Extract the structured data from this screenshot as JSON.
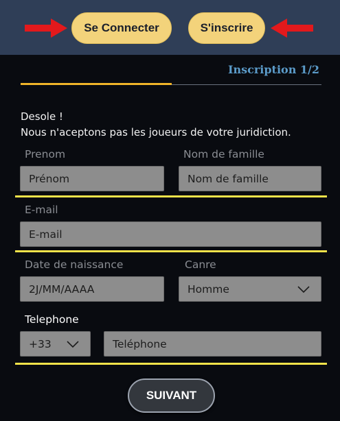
{
  "header": {
    "login_label": "Se Connecter",
    "signup_label": "S'inscrire"
  },
  "step": {
    "title": "Inscription 1/2"
  },
  "message": {
    "line1": "Desole !",
    "line2": "Nous n'aceptons pas les joueurs de votre juridiction."
  },
  "form": {
    "firstname": {
      "label": "Prenom",
      "value": "Prénom"
    },
    "lastname": {
      "label": "Nom de famille",
      "value": "Nom de famille"
    },
    "email": {
      "label": "E-mail",
      "value": "E-mail"
    },
    "birthdate": {
      "label": "Date de naissance",
      "value": "2J/MM/AAAA"
    },
    "gender": {
      "label": "Canre",
      "value": "Homme"
    },
    "phone": {
      "label": "Telephone",
      "prefix": "+33",
      "value": "Teléphone"
    }
  },
  "submit_label": "SUIVANT",
  "colors": {
    "topbar": "#2f3e57",
    "pill": "#f3d37b",
    "accent_tab": "#f0b429",
    "separator": "#f5e34a",
    "step_title": "#5b9bc9",
    "arrow": "#e3191c"
  },
  "icons": {
    "arrows": "red-arrow-icon",
    "dropdown": "chevron-down-icon"
  }
}
